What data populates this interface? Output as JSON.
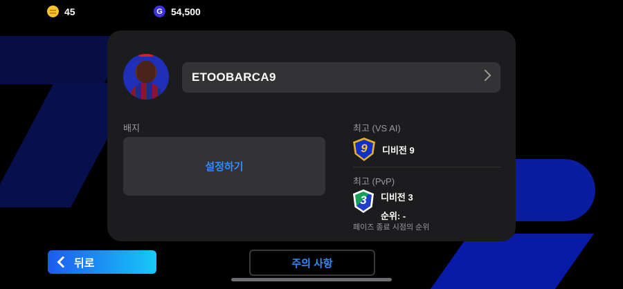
{
  "topbar": {
    "coins": "45",
    "gp": "54,500",
    "gp_icon_glyph": "G"
  },
  "profile": {
    "name": "ETOOBARCA9"
  },
  "badge": {
    "label": "배지",
    "setup": "설정하기"
  },
  "best_ai": {
    "label": "최고 (VS AI)",
    "badge_number": "9",
    "division": "디비전 9"
  },
  "best_pvp": {
    "label": "최고 (PvP)",
    "badge_number": "3",
    "division": "디비전 3",
    "rank": "순위: -",
    "note": "페이즈 종료 시점의 순위"
  },
  "footer": {
    "back_label": "뒤로",
    "notice_label": "주의 사항"
  },
  "colors": {
    "accent_blue": "#2f8cff",
    "card_bg": "#1c1c1e",
    "field_bg": "#333336"
  }
}
